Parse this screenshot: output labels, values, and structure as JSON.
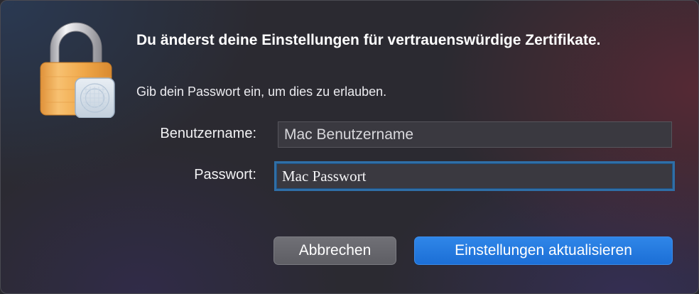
{
  "dialog": {
    "title": "Du änderst deine Einstellungen für vertrauenswürdige Zertifikate.",
    "subtitle": "Gib dein Passwort ein, um dies zu erlauben.",
    "icon": "lock-with-certificate-icon"
  },
  "fields": {
    "username": {
      "label": "Benutzername:",
      "value": "Mac Benutzername"
    },
    "password": {
      "label": "Passwort:",
      "value": "Mac Passwort"
    }
  },
  "buttons": {
    "cancel": "Abbrechen",
    "confirm": "Einstellungen aktualisieren"
  },
  "colors": {
    "accent": "#1c6fd6",
    "focus_ring": "#2f6fa7",
    "lock_body": "#f0a84a"
  }
}
